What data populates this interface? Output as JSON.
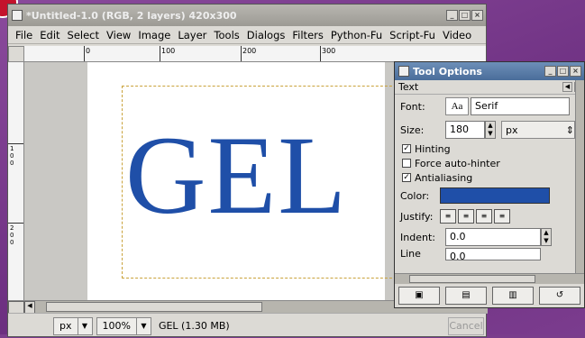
{
  "main_window": {
    "title": "*Untitled-1.0 (RGB, 2 layers) 420x300",
    "menu": [
      "File",
      "Edit",
      "Select",
      "View",
      "Image",
      "Layer",
      "Tools",
      "Dialogs",
      "Filters",
      "Python-Fu",
      "Script-Fu",
      "Video"
    ],
    "ruler_labels": [
      "0",
      "100",
      "200",
      "300"
    ],
    "vruler_labels": [
      "100",
      "200"
    ],
    "canvas_text": "GEL",
    "canvas_text_color": "#1f4fa8",
    "status": {
      "unit": "px",
      "zoom": "100%",
      "message": "GEL (1.30 MB)",
      "cancel": "Cancel"
    }
  },
  "tool_options": {
    "title": "Tool Options",
    "tab_label": "Text",
    "font_label": "Font:",
    "font_preview": "Aa",
    "font_value": "Serif",
    "size_label": "Size:",
    "size_value": "180",
    "size_unit": "px",
    "hinting": {
      "label": "Hinting",
      "checked": true
    },
    "force_autohinter": {
      "label": "Force auto-hinter",
      "checked": false
    },
    "antialiasing": {
      "label": "Antialiasing",
      "checked": true
    },
    "color_label": "Color:",
    "color_value": "#1f4fa8",
    "justify_label": "Justify:",
    "indent_label": "Indent:",
    "indent_value": "0.0",
    "line_label": "Line",
    "line_value": "0.0"
  }
}
